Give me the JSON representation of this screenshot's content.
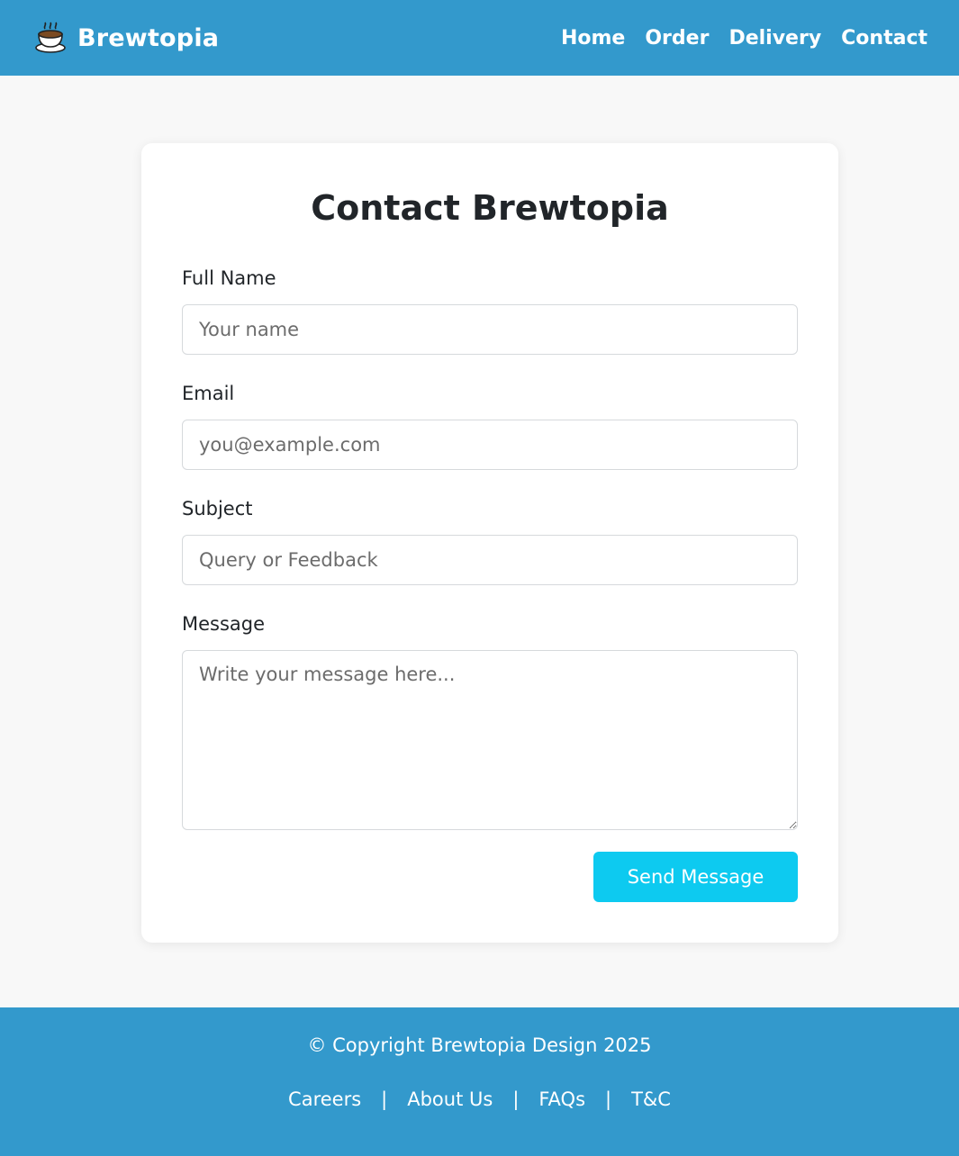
{
  "header": {
    "brand_name": "Brewtopia",
    "brand_icon": "coffee-cup-icon",
    "nav": [
      {
        "label": "Home"
      },
      {
        "label": "Order"
      },
      {
        "label": "Delivery"
      },
      {
        "label": "Contact"
      }
    ]
  },
  "form": {
    "title": "Contact Brewtopia",
    "fields": {
      "name": {
        "label": "Full Name",
        "placeholder": "Your name",
        "value": ""
      },
      "email": {
        "label": "Email",
        "placeholder": "you@example.com",
        "value": ""
      },
      "subject": {
        "label": "Subject",
        "placeholder": "Query or Feedback",
        "value": ""
      },
      "message": {
        "label": "Message",
        "placeholder": "Write your message here...",
        "value": ""
      }
    },
    "submit_label": "Send Message"
  },
  "footer": {
    "copyright": "© Copyright Brewtopia Design 2025",
    "links": [
      {
        "label": "Careers"
      },
      {
        "label": "About Us"
      },
      {
        "label": "FAQs"
      },
      {
        "label": "T&C"
      }
    ],
    "separator": "|"
  },
  "colors": {
    "primary": "#3399cc",
    "button": "#0dcaf0",
    "background": "#f8f8f8",
    "card": "#ffffff"
  }
}
